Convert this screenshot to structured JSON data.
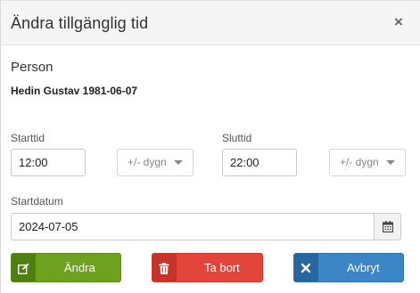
{
  "dialog": {
    "title": "Ändra tillgänglig tid",
    "close_symbol": "×"
  },
  "person": {
    "label": "Person",
    "name": "Hedin Gustav 1981-06-07"
  },
  "start": {
    "label": "Starttid",
    "value": "12:00",
    "day_offset": "+/- dygn"
  },
  "end": {
    "label": "Sluttid",
    "value": "22:00",
    "day_offset": "+/- dygn"
  },
  "date": {
    "label": "Startdatum",
    "value": "2024-07-05",
    "icon": "calendar-icon"
  },
  "buttons": {
    "edit": {
      "label": "Ändra",
      "icon": "edit-icon",
      "color": "#6ea11f"
    },
    "delete": {
      "label": "Ta bort",
      "icon": "trash-icon",
      "color": "#e4453b"
    },
    "cancel": {
      "label": "Avbryt",
      "icon": "close-icon",
      "color": "#3a86c6"
    }
  }
}
